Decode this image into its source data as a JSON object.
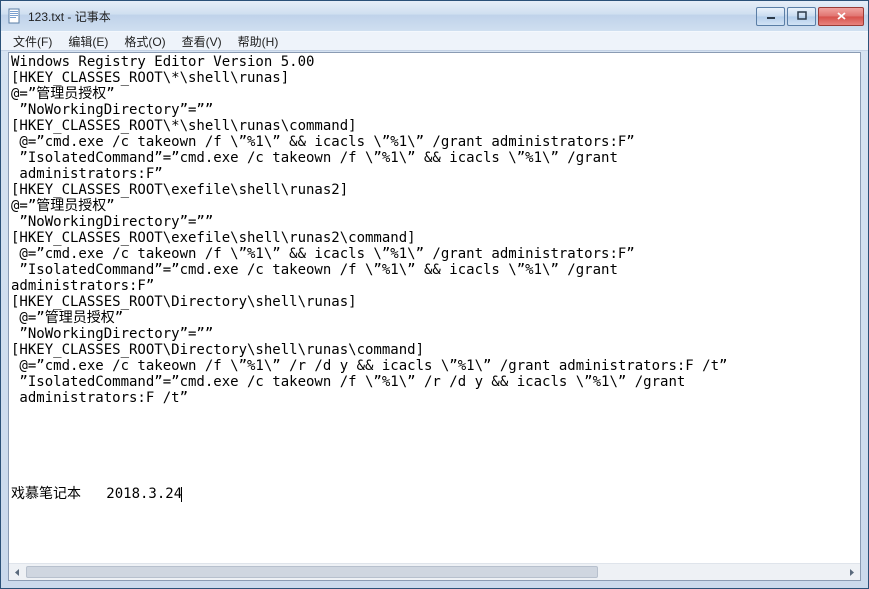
{
  "title": "123.txt - 记事本",
  "menu": {
    "file": "文件(F)",
    "edit": "编辑(E)",
    "format": "格式(O)",
    "view": "查看(V)",
    "help": "帮助(H)"
  },
  "content": {
    "lines": [
      "Windows Registry Editor Version 5.00",
      "[HKEY_CLASSES_ROOT\\*\\shell\\runas]",
      "@=”管理员授权”",
      " ”NoWorkingDirectory”=””",
      "[HKEY_CLASSES_ROOT\\*\\shell\\runas\\command]",
      " @=”cmd.exe /c takeown /f \\”%1\\” && icacls \\”%1\\” /grant administrators:F”",
      " ”IsolatedCommand”=”cmd.exe /c takeown /f \\”%1\\” && icacls \\”%1\\” /grant",
      " administrators:F”",
      "[HKEY_CLASSES_ROOT\\exefile\\shell\\runas2]",
      "@=”管理员授权”",
      " ”NoWorkingDirectory”=””",
      "[HKEY_CLASSES_ROOT\\exefile\\shell\\runas2\\command]",
      " @=”cmd.exe /c takeown /f \\”%1\\” && icacls \\”%1\\” /grant administrators:F”",
      " ”IsolatedCommand”=”cmd.exe /c takeown /f \\”%1\\” && icacls \\”%1\\” /grant",
      "administrators:F”",
      "[HKEY_CLASSES_ROOT\\Directory\\shell\\runas]",
      " @=”管理员授权”",
      " ”NoWorkingDirectory”=””",
      "[HKEY_CLASSES_ROOT\\Directory\\shell\\runas\\command]",
      " @=”cmd.exe /c takeown /f \\”%1\\” /r /d y && icacls \\”%1\\” /grant administrators:F /t”",
      " ”IsolatedCommand”=”cmd.exe /c takeown /f \\”%1\\” /r /d y && icacls \\”%1\\” /grant",
      " administrators:F /t”",
      "",
      "",
      "",
      "",
      "",
      "戏慕笔记本   2018.3.24"
    ]
  }
}
